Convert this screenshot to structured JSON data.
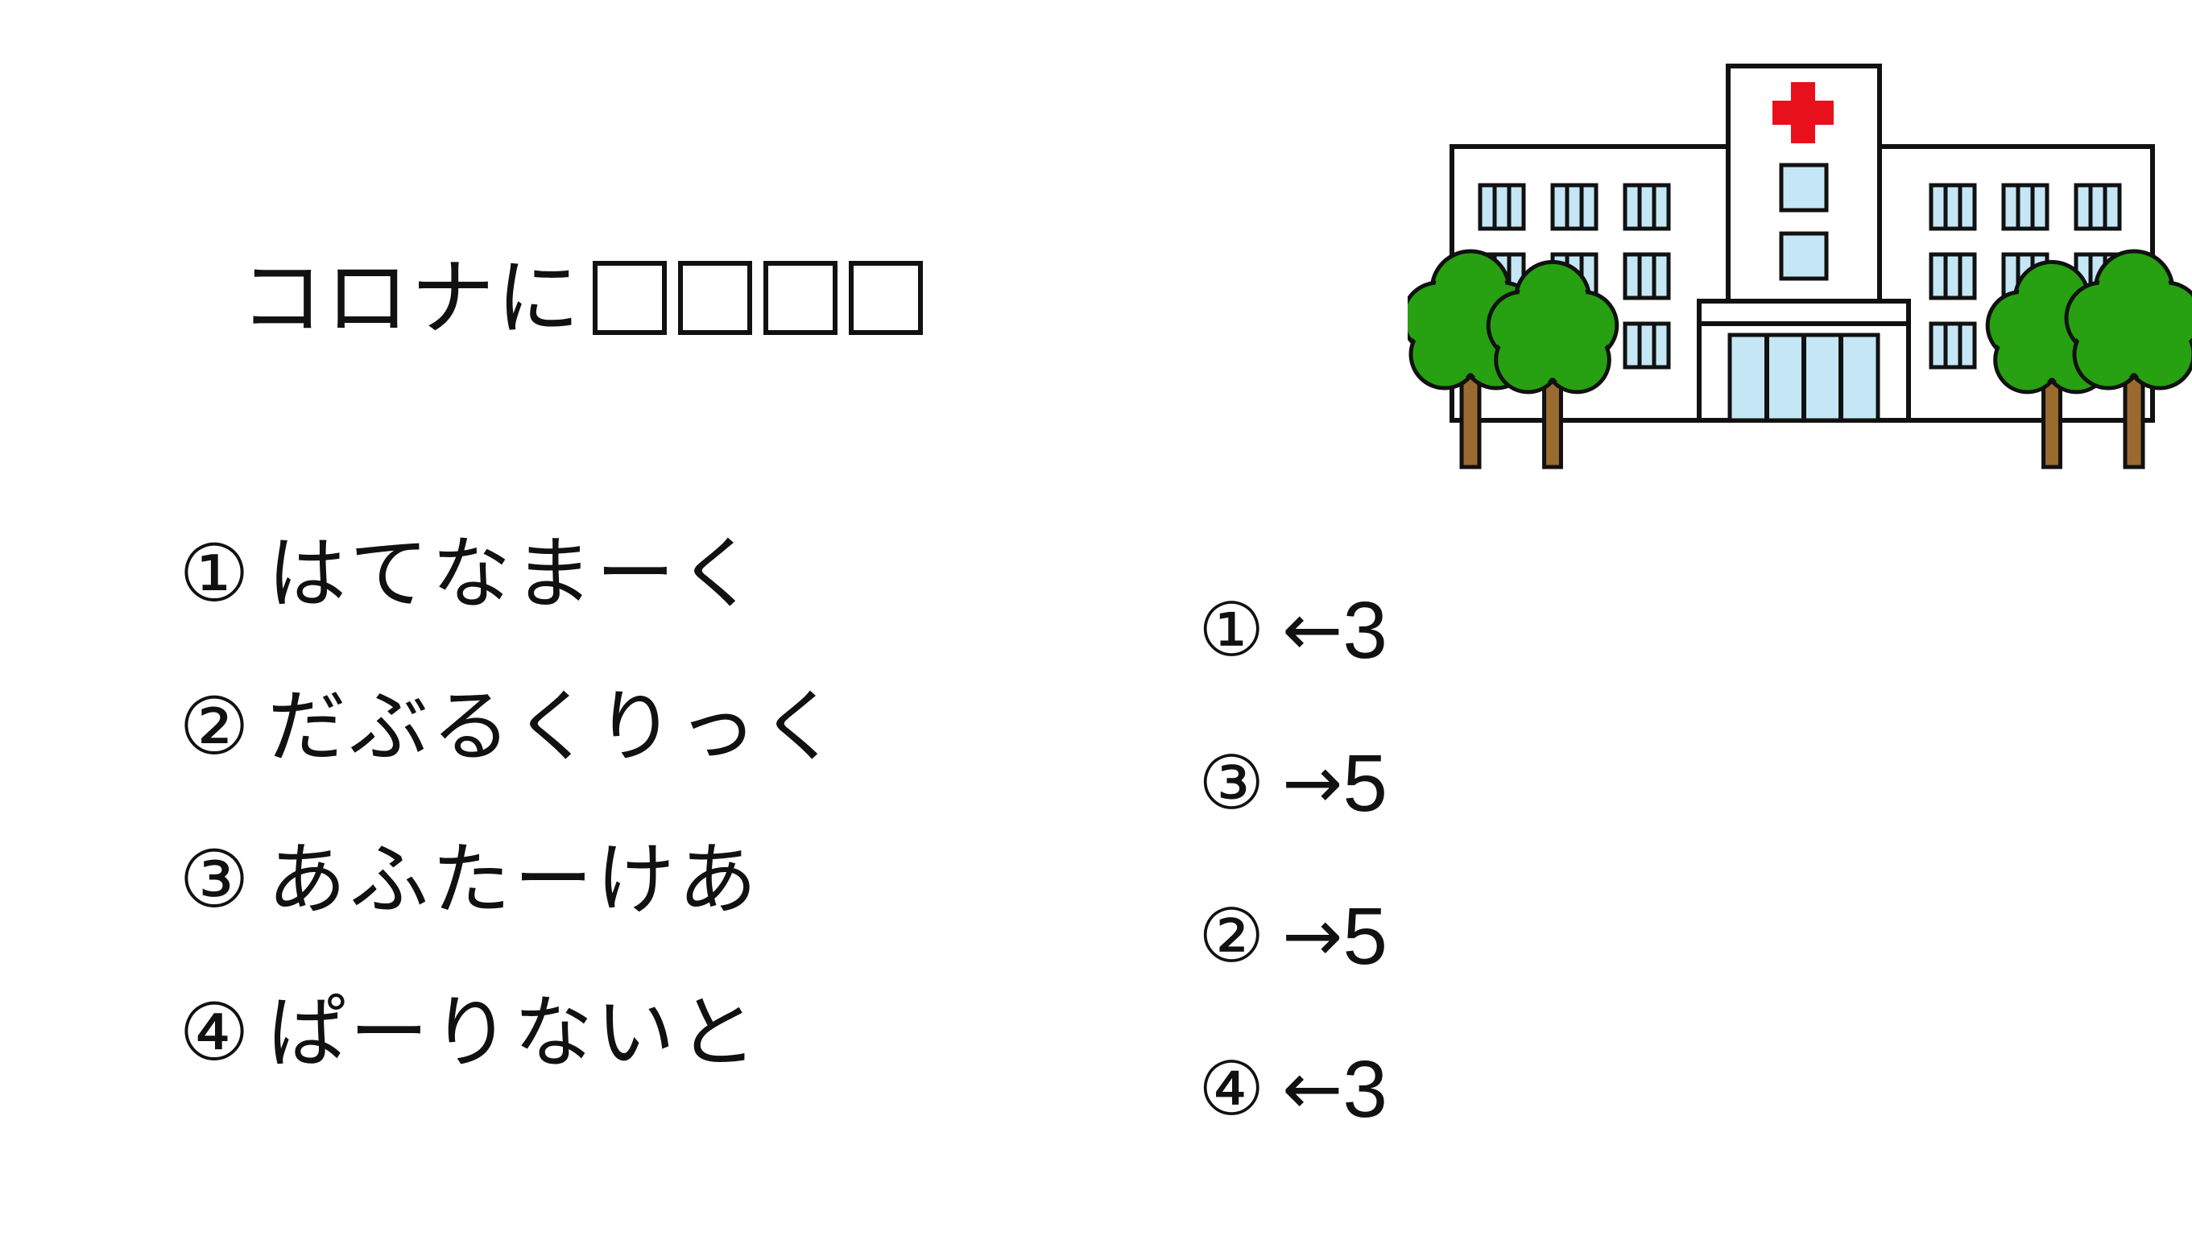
{
  "slide": {
    "title_prefix": "コロナに",
    "blank_count": 4,
    "choices": [
      {
        "number": "①",
        "text": "はてなまーく"
      },
      {
        "number": "②",
        "text": "だぶるくりっく"
      },
      {
        "number": "③",
        "text": "あふたーけあ"
      },
      {
        "number": "④",
        "text": "ぱーりないと"
      }
    ],
    "hints": [
      {
        "number": "①",
        "arrow": "←",
        "count": "3"
      },
      {
        "number": "③",
        "arrow": "→",
        "count": "5"
      },
      {
        "number": "②",
        "arrow": "→",
        "count": "5"
      },
      {
        "number": "④",
        "arrow": "←",
        "count": "3"
      }
    ],
    "illustration": {
      "icon": "hospital-icon",
      "cross_color": "#e8101a",
      "window_color": "#c5e6f5",
      "foliage_color": "#27a012",
      "trunk_color": "#9a6a2f"
    }
  }
}
